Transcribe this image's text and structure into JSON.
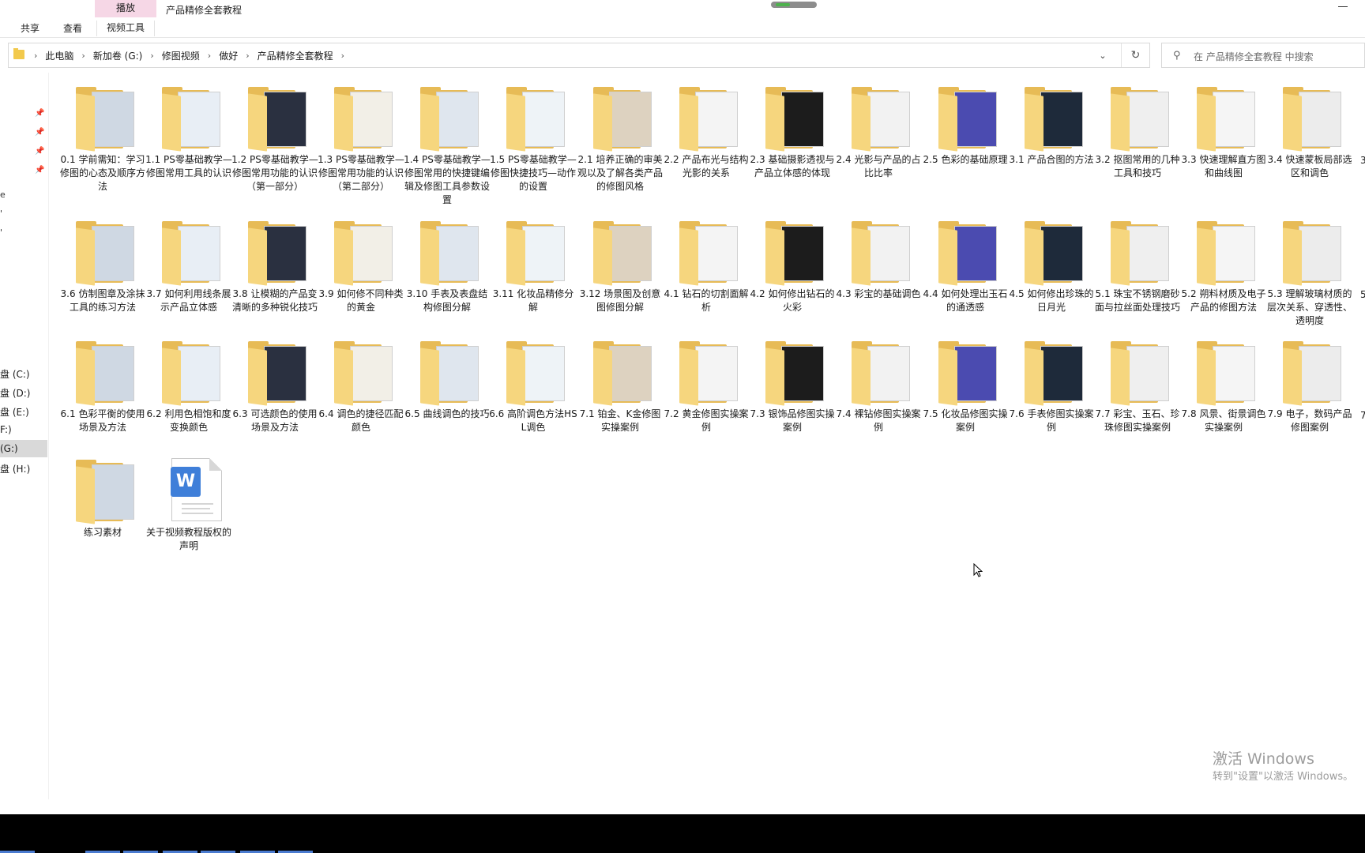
{
  "ribbon": {
    "context_group": "播放",
    "window_title": "产品精修全套教程",
    "tabs": [
      {
        "label": "共享"
      },
      {
        "label": "查看"
      },
      {
        "label": "视频工具"
      }
    ],
    "context_color": "#f6d7e6"
  },
  "address": {
    "crumbs": [
      "此电脑",
      "新加卷 (G:)",
      "修图视频",
      "做好",
      "产品精修全套教程"
    ]
  },
  "search": {
    "placeholder": "在 产品精修全套教程 中搜索"
  },
  "nav": {
    "fragments": [
      "e",
      "'",
      "'"
    ],
    "drives": [
      "盘 (C:)",
      "盘 (D:)",
      "盘 (E:)",
      "F:)",
      "(G:)",
      "盘 (H:)"
    ],
    "selected_drive_index": 4
  },
  "items": [
    {
      "label": "0.1 学前需知：学习修图的心态及顺序方法",
      "type": "folder"
    },
    {
      "label": "1.1 PS零基础教学—修图常用工具的认识",
      "type": "folder"
    },
    {
      "label": "1.2 PS零基础教学—修图常用功能的认识（第一部分）",
      "type": "folder"
    },
    {
      "label": "1.3 PS零基础教学—修图常用功能的认识（第二部分）",
      "type": "folder"
    },
    {
      "label": "1.4 PS零基础教学—修图常用的快捷键编辑及修图工具参数设置",
      "type": "folder"
    },
    {
      "label": "1.5 PS零基础教学—修图快捷技巧—动作的设置",
      "type": "folder"
    },
    {
      "label": "2.1 培养正确的审美观以及了解各类产品的修图风格",
      "type": "folder"
    },
    {
      "label": "2.2 产品布光与结构光影的关系",
      "type": "folder"
    },
    {
      "label": "2.3 基础摄影透视与产品立体感的体现",
      "type": "folder"
    },
    {
      "label": "2.4 光影与产品的占比比率",
      "type": "folder"
    },
    {
      "label": "2.5 色彩的基础原理",
      "type": "folder"
    },
    {
      "label": "3.1 产品合图的方法",
      "type": "folder"
    },
    {
      "label": "3.2 抠图常用的几种工具和技巧",
      "type": "folder"
    },
    {
      "label": "3.3 快速理解直方图和曲线图",
      "type": "folder"
    },
    {
      "label": "3.4 快速蒙板局部选区和调色",
      "type": "folder"
    },
    {
      "label": "3.6 仿制图章及涂抹工具的练习方法",
      "type": "folder"
    },
    {
      "label": "3.7 如何利用线条展示产品立体感",
      "type": "folder"
    },
    {
      "label": "3.8 让模糊的产品变清晰的多种锐化技巧",
      "type": "folder"
    },
    {
      "label": "3.9 如何修不同种类的黄金",
      "type": "folder"
    },
    {
      "label": "3.10 手表及表盘结构修图分解",
      "type": "folder"
    },
    {
      "label": "3.11 化妆品精修分解",
      "type": "folder"
    },
    {
      "label": "3.12 场景图及创意图修图分解",
      "type": "folder"
    },
    {
      "label": "4.1 钻石的切割面解析",
      "type": "folder"
    },
    {
      "label": "4.2 如何修出钻石的火彩",
      "type": "folder"
    },
    {
      "label": "4.3 彩宝的基础调色",
      "type": "folder"
    },
    {
      "label": "4.4 如何处理出玉石的通透感",
      "type": "folder"
    },
    {
      "label": "4.5 如何修出珍珠的日月光",
      "type": "folder"
    },
    {
      "label": "5.1 珠宝不锈钢磨砂面与拉丝面处理技巧",
      "type": "folder"
    },
    {
      "label": "5.2 朔料材质及电子产品的修图方法",
      "type": "folder"
    },
    {
      "label": "5.3 理解玻璃材质的层次关系、穿透性、透明度",
      "type": "folder"
    },
    {
      "label": "6.1 色彩平衡的使用场景及方法",
      "type": "folder"
    },
    {
      "label": "6.2 利用色相饱和度变换颜色",
      "type": "folder"
    },
    {
      "label": "6.3 可选颜色的使用场景及方法",
      "type": "folder"
    },
    {
      "label": "6.4 调色的捷径匹配颜色",
      "type": "folder"
    },
    {
      "label": "6.5 曲线调色的技巧",
      "type": "folder"
    },
    {
      "label": "6.6 高阶调色方法HSL调色",
      "type": "folder"
    },
    {
      "label": "7.1 铂金、K金修图实操案例",
      "type": "folder"
    },
    {
      "label": "7.2 黄金修图实操案例",
      "type": "folder"
    },
    {
      "label": "7.3 银饰品修图实操案例",
      "type": "folder"
    },
    {
      "label": "7.4 裸钻修图实操案例",
      "type": "folder"
    },
    {
      "label": "7.5 化妆品修图实操案例",
      "type": "folder"
    },
    {
      "label": "7.6 手表修图实操案例",
      "type": "folder"
    },
    {
      "label": "7.7 彩宝、玉石、珍珠修图实操案例",
      "type": "folder"
    },
    {
      "label": "7.8 风景、街景调色实操案例",
      "type": "folder"
    },
    {
      "label": "7.9 电子，数码产品修图案例",
      "type": "folder"
    },
    {
      "label": "练习素材",
      "type": "folder"
    },
    {
      "label": "关于视频教程版权的声明",
      "type": "word-document"
    }
  ],
  "right_edge_fragments": [
    "3",
    "5",
    "7"
  ],
  "watermark": {
    "line1": "激活 Windows",
    "line2": "转到\"设置\"以激活 Windows。"
  },
  "colors": {
    "folder": "#e7bb56",
    "word_icon": "#3f7fd9",
    "selection": "#d9d9d9"
  }
}
